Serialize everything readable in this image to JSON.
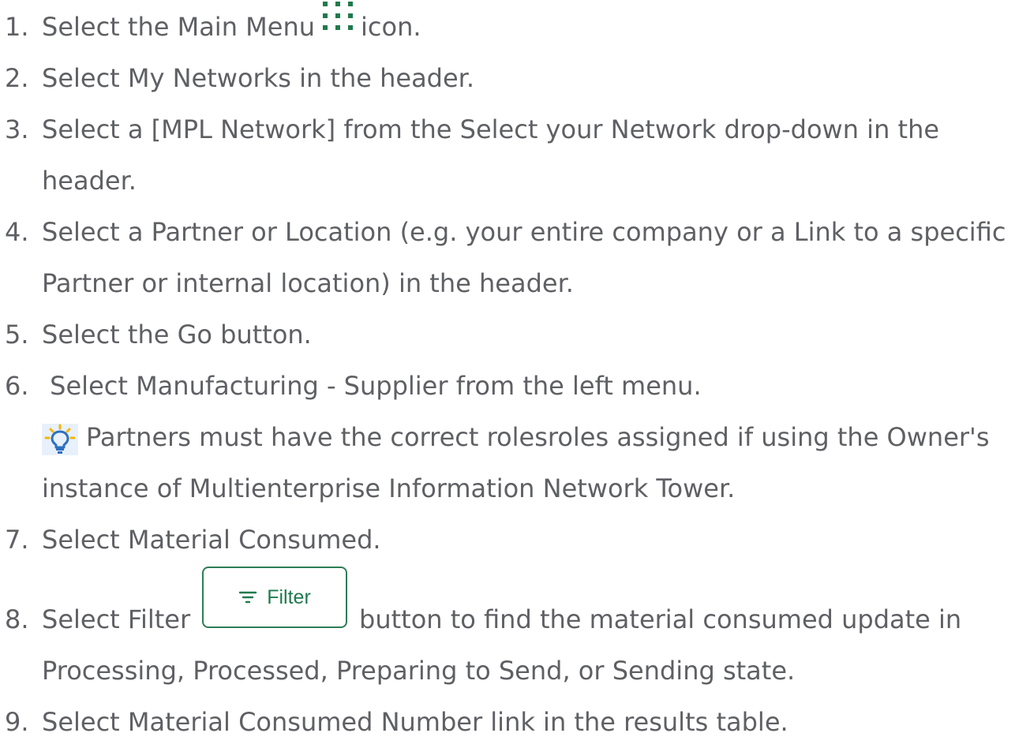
{
  "steps": [
    {
      "num": "1.",
      "before": "Select the Main Menu",
      "after": "icon."
    },
    {
      "num": "2.",
      "text": "Select My Networks in the header."
    },
    {
      "num": "3.",
      "text": "Select a [MPL Network] from the Select your Network drop-down in the",
      "cont": "header."
    },
    {
      "num": "4.",
      "text": "Select a Partner or Location (e.g. your entire company or a Link to a specific",
      "cont": "Partner or internal location) in the header."
    },
    {
      "num": "5.",
      "text": "Select the Go button."
    },
    {
      "num": "6.",
      "text": " Select Manufacturing - Supplier from the left menu."
    },
    {
      "num": "7.",
      "text": "Select Material Consumed."
    },
    {
      "num": "8.",
      "before": "Select Filter",
      "after": "button to find the material consumed update in",
      "cont": "Processing, Processed, Preparing to Send, or Sending state."
    },
    {
      "num": "9.",
      "text": "Select Material Consumed Number link in the results table."
    }
  ],
  "tip": {
    "line1": "Partners must have the correct rolesroles assigned if using the Owner's",
    "line2": "instance of Multienterprise Information Network Tower."
  },
  "filter_button": {
    "label": "Filter"
  },
  "icons": {
    "main_menu": "grid-dots-icon",
    "tip": "lightbulb-icon",
    "filter": "filter-lines-icon"
  },
  "colors": {
    "text": "#5f6064",
    "accent_green": "#1f7a4d",
    "tip_yellow": "#f2b705",
    "tip_bg": "#e8f1fb"
  }
}
